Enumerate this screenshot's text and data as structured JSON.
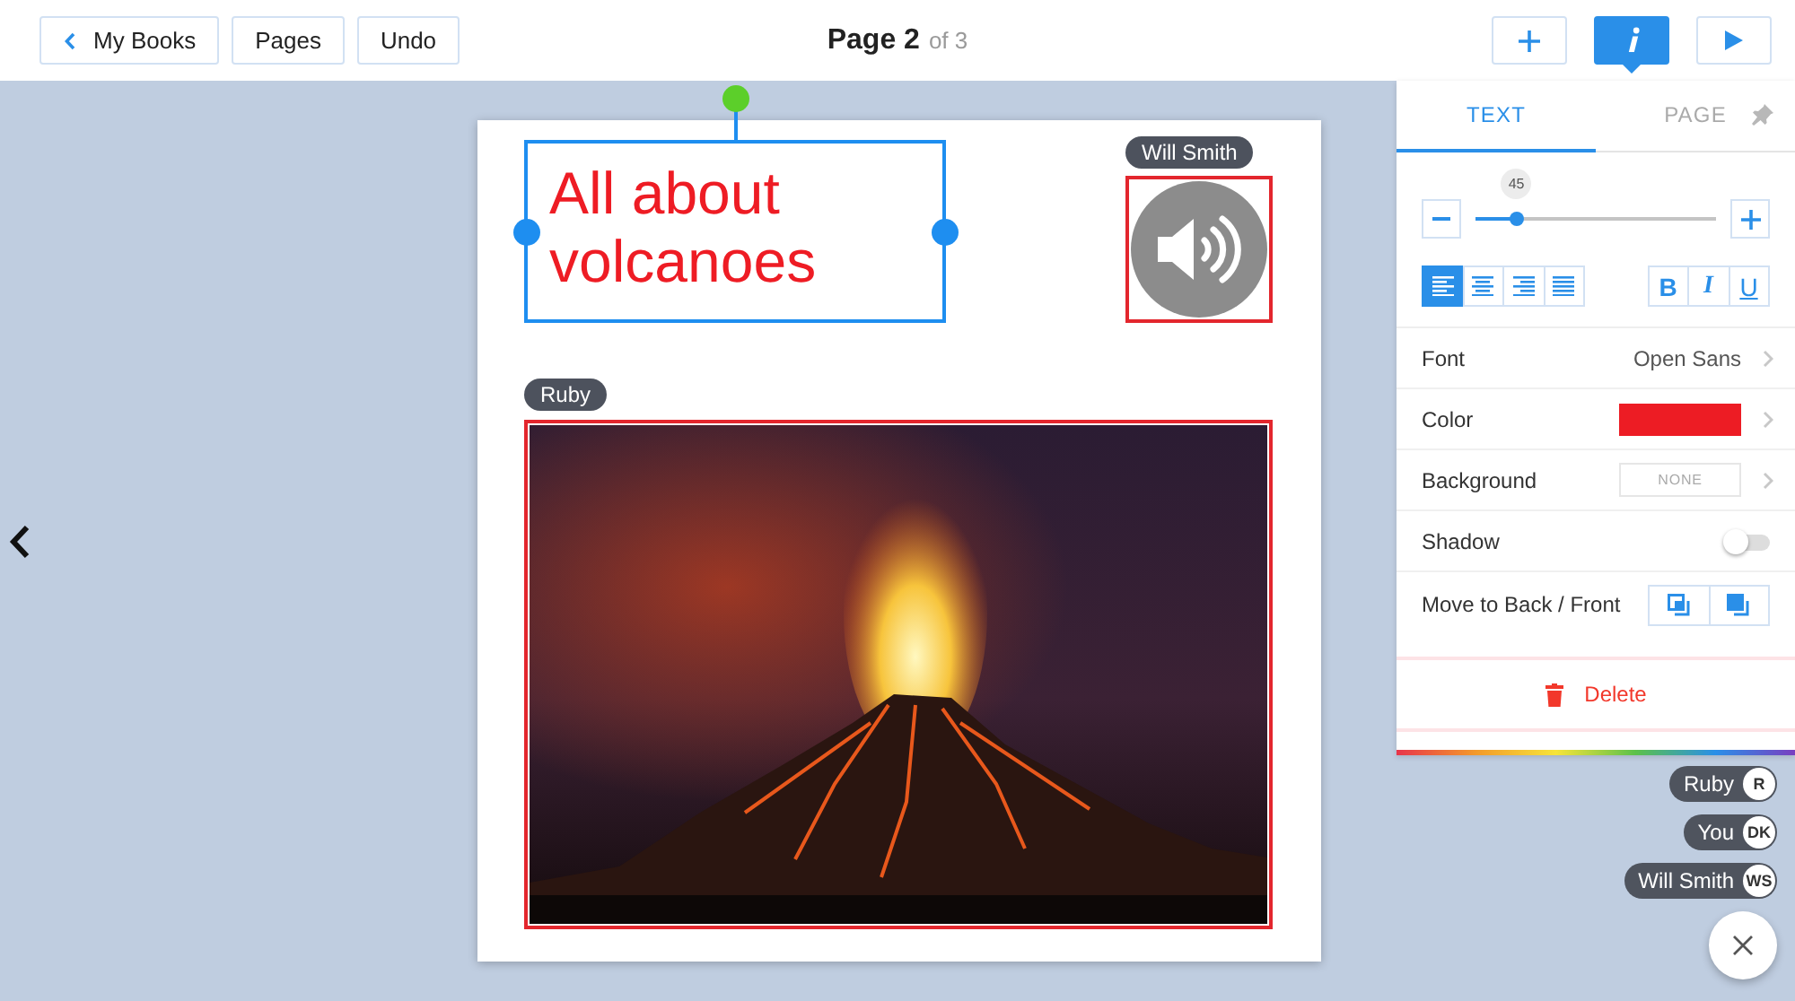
{
  "toolbar": {
    "left_buttons": [
      {
        "kind": "back",
        "label": "My Books"
      },
      {
        "kind": "plain",
        "label": "Pages"
      },
      {
        "kind": "plain",
        "label": "Undo"
      }
    ],
    "page_title": "Page 2",
    "page_count": "of 3",
    "right_buttons": [
      {
        "kind": "add",
        "selected": false
      },
      {
        "kind": "info",
        "selected": true
      },
      {
        "kind": "play",
        "selected": false
      }
    ]
  },
  "page": {
    "elements": [
      {
        "kind": "text",
        "text": "All about volcanoes",
        "selected": true
      },
      {
        "kind": "audio",
        "selected": false,
        "editor": "Will Smith"
      },
      {
        "kind": "photo",
        "selected": false,
        "editor": "Ruby"
      }
    ]
  },
  "panel": {
    "tabs": [
      {
        "label": "TEXT",
        "selected": true
      },
      {
        "label": "PAGE",
        "selected": false
      }
    ],
    "size": {
      "value": "45",
      "level": 0.17
    },
    "alignment": [
      {
        "kind": "left",
        "selected": true
      },
      {
        "kind": "center",
        "selected": false
      },
      {
        "kind": "right",
        "selected": false
      },
      {
        "kind": "justify",
        "selected": false
      }
    ],
    "styles": [
      {
        "kind": "bold",
        "label": "B",
        "selected": false
      },
      {
        "kind": "italic",
        "label": "I",
        "selected": false
      },
      {
        "kind": "underline",
        "label": "U",
        "selected": false
      }
    ],
    "rows": [
      {
        "kind": "link",
        "label": "Font",
        "value": "Open Sans"
      },
      {
        "kind": "color",
        "label": "Color",
        "color": "#ed1c24"
      },
      {
        "kind": "option",
        "label": "Background",
        "value": "NONE"
      },
      {
        "kind": "toggle",
        "label": "Shadow",
        "on": false
      },
      {
        "kind": "order",
        "label": "Move to Back / Front"
      }
    ],
    "delete_label": "Delete"
  },
  "collaborators": [
    {
      "name": "Ruby",
      "initials": "R"
    },
    {
      "name": "You",
      "initials": "DK"
    },
    {
      "name": "Will Smith",
      "initials": "WS"
    }
  ]
}
